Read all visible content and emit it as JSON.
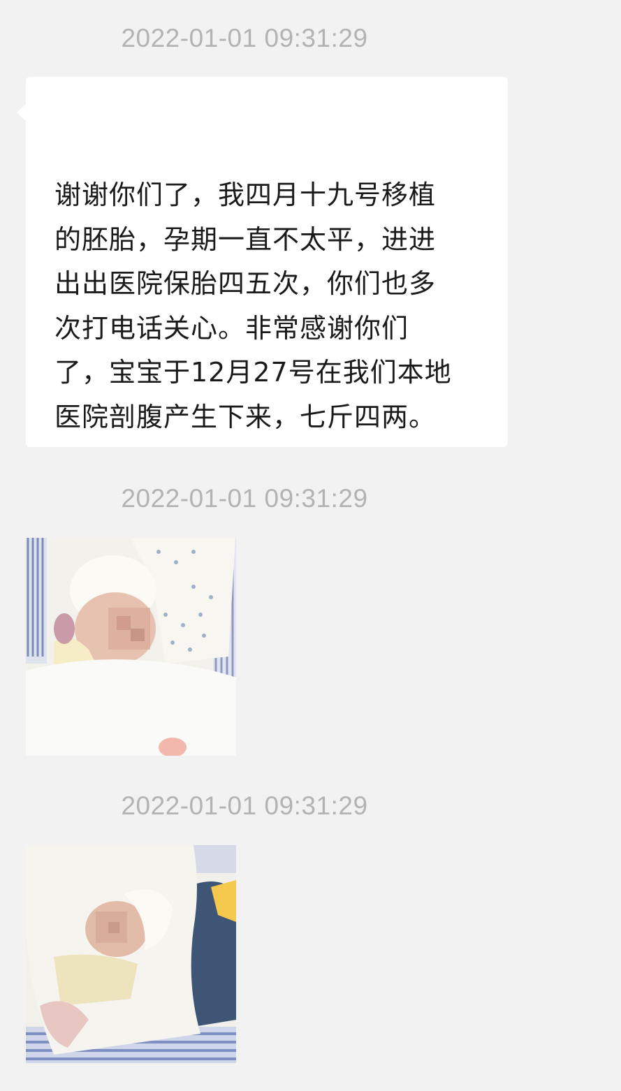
{
  "chat": {
    "messages": [
      {
        "timestamp": "2022-01-01 09:31:29",
        "type": "text",
        "text": "谢谢你们了，我四月十九号移植\n的胚胎，孕期一直不太平，进进\n出出医院保胎四五次，你们也多\n次打电话关心。非常感谢你们\n了，宝宝于12月27号在我们本地\n医院剖腹产生下来，七斤四两。"
      },
      {
        "timestamp": "2022-01-01 09:31:29",
        "type": "image",
        "image_subject": "newborn-baby-photo"
      },
      {
        "timestamp": "2022-01-01 09:31:29",
        "type": "image",
        "image_subject": "newborn-baby-wrapped-photo"
      }
    ]
  },
  "colors": {
    "background": "#f2f2f2",
    "bubble": "#ffffff",
    "timestamp_text": "#b3b3b3",
    "message_text": "#1a1a1a"
  }
}
